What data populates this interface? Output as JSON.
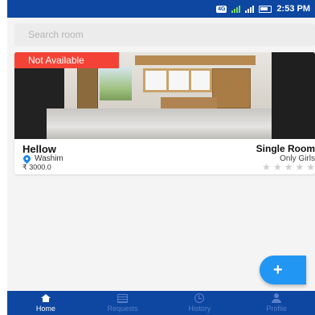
{
  "status_bar": {
    "network_badge": "4G",
    "time": "2:53 PM"
  },
  "search": {
    "placeholder": "Search room"
  },
  "rooms": [
    {
      "availability_badge": "Not Available",
      "name": "Hellow",
      "location": "Washim",
      "price": "₹ 3000.0",
      "room_type": "Single Room",
      "gender": "Only Girls",
      "rating": 0,
      "rating_max": 5,
      "rating_stars": [
        "★",
        "★",
        "★",
        "★",
        "★"
      ]
    }
  ],
  "fab": {
    "icon": "plus-icon",
    "label": "+"
  },
  "bottom_nav": {
    "items": [
      {
        "label": "Home",
        "icon": "home-icon",
        "active": true
      },
      {
        "label": "Requests",
        "icon": "list-icon",
        "active": false
      },
      {
        "label": "History",
        "icon": "history-icon",
        "active": false
      },
      {
        "label": "Profile",
        "icon": "person-icon",
        "active": false
      }
    ]
  },
  "colors": {
    "primary": "#0d47a1",
    "accent": "#2196f3",
    "badge_red": "#f44336",
    "nav_inactive": "#5a7fc8",
    "star_empty": "#cfcfcf"
  }
}
